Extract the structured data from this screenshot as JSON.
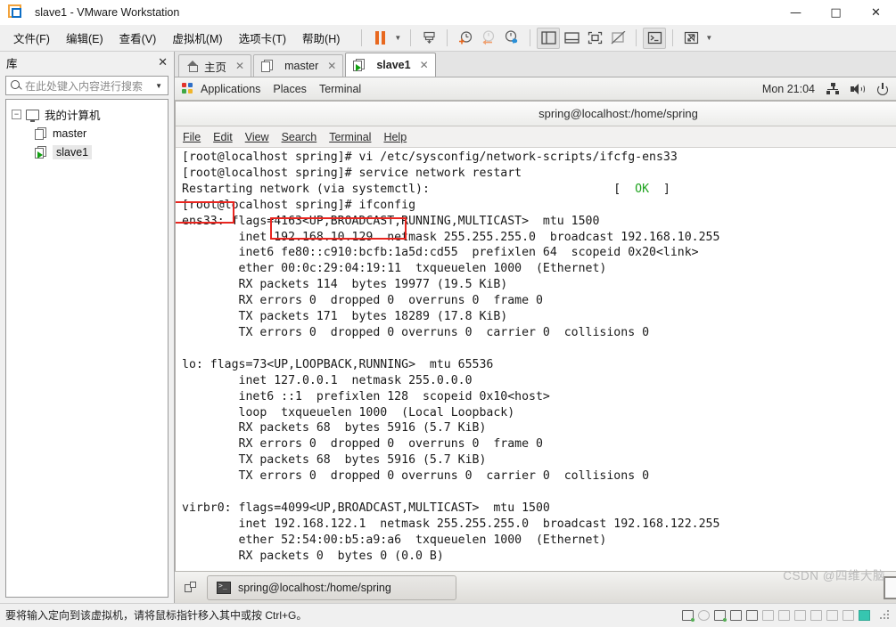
{
  "window": {
    "title": "slave1 - VMware Workstation",
    "controls": {
      "minimize": "—",
      "maximize": "□",
      "close": "✕"
    }
  },
  "menubar": {
    "items": [
      {
        "label": "文件(F)",
        "name": "menu-file"
      },
      {
        "label": "编辑(E)",
        "name": "menu-edit"
      },
      {
        "label": "查看(V)",
        "name": "menu-view"
      },
      {
        "label": "虚拟机(M)",
        "name": "menu-vm"
      },
      {
        "label": "选项卡(T)",
        "name": "menu-tabs"
      },
      {
        "label": "帮助(H)",
        "name": "menu-help"
      }
    ]
  },
  "toolbar": {
    "buttons": [
      "pause-button",
      "pause-dropdown",
      "power-settings-button",
      "snapshot-take-button",
      "snapshot-revert-button",
      "snapshot-manager-button",
      "show-library-button",
      "show-thumbnails-button",
      "fullscreen-button",
      "unity-button",
      "console-view-button",
      "stretch-button",
      "stretch-dropdown"
    ]
  },
  "library": {
    "title": "库",
    "close": "✕",
    "search_placeholder": "在此处键入内容进行搜索",
    "tree": [
      {
        "label": "我的计算机",
        "level": 0,
        "expander": "−",
        "icon": "monitor-icon",
        "selected": false
      },
      {
        "label": "master",
        "level": 1,
        "icon": "vm-icon",
        "selected": false,
        "running": false
      },
      {
        "label": "slave1",
        "level": 1,
        "icon": "vm-running-icon",
        "selected": true,
        "running": true
      }
    ]
  },
  "tabs": [
    {
      "label": "主页",
      "icon": "home-icon",
      "active": false,
      "close": "✕"
    },
    {
      "label": "master",
      "icon": "vm-icon",
      "active": false,
      "close": "✕"
    },
    {
      "label": "slave1",
      "icon": "vm-running-icon",
      "active": true,
      "close": "✕"
    }
  ],
  "guest": {
    "panel": {
      "menus": [
        "Applications",
        "Places",
        "Terminal"
      ],
      "clock": "Mon 21:04",
      "tray": [
        "network-icon",
        "volume-icon",
        "power-icon"
      ]
    },
    "terminal": {
      "title": "spring@localhost:/home/spring",
      "controls": {
        "minimize": "_",
        "maximize": "▫",
        "close": "✕"
      },
      "menus": [
        "File",
        "Edit",
        "View",
        "Search",
        "Terminal",
        "Help"
      ],
      "lines": [
        "[root@localhost spring]# vi /etc/sysconfig/network-scripts/ifcfg-ens33",
        "[root@localhost spring]# service network restart",
        "Restarting network (via systemctl):                          [  OK  ]",
        "[root@localhost spring]# ifconfig",
        "ens33: flags=4163<UP,BROADCAST,RUNNING,MULTICAST>  mtu 1500",
        "        inet 192.168.10.129  netmask 255.255.255.0  broadcast 192.168.10.255",
        "        inet6 fe80::c910:bcfb:1a5d:cd55  prefixlen 64  scopeid 0x20<link>",
        "        ether 00:0c:29:04:19:11  txqueuelen 1000  (Ethernet)",
        "        RX packets 114  bytes 19977 (19.5 KiB)",
        "        RX errors 0  dropped 0  overruns 0  frame 0",
        "        TX packets 171  bytes 18289 (17.8 KiB)",
        "        TX errors 0  dropped 0 overruns 0  carrier 0  collisions 0",
        "",
        "lo: flags=73<UP,LOOPBACK,RUNNING>  mtu 65536",
        "        inet 127.0.0.1  netmask 255.0.0.0",
        "        inet6 ::1  prefixlen 128  scopeid 0x10<host>",
        "        loop  txqueuelen 1000  (Local Loopback)",
        "        RX packets 68  bytes 5916 (5.7 KiB)",
        "        RX errors 0  dropped 0  overruns 0  frame 0",
        "        TX packets 68  bytes 5916 (5.7 KiB)",
        "        TX errors 0  dropped 0 overruns 0  carrier 0  collisions 0",
        "",
        "virbr0: flags=4099<UP,BROADCAST,MULTICAST>  mtu 1500",
        "        inet 192.168.122.1  netmask 255.255.255.0  broadcast 192.168.122.255",
        "        ether 52:54:00:b5:a9:a6  txqueuelen 1000  (Ethernet)",
        "        RX packets 0  bytes 0 (0.0 B)"
      ],
      "ok_status": "OK"
    },
    "taskbar": {
      "window_button": "spring@localhost:/home/spring",
      "workspaces": 4,
      "active_workspace": 1
    },
    "annotations": [
      {
        "name": "highlight-interface-name",
        "target": "ens33:",
        "color": "#e8251f"
      },
      {
        "name": "highlight-ip-address",
        "target": "192.168.10.129",
        "color": "#e8251f"
      }
    ]
  },
  "statusbar": {
    "hint": "要将输入定向到该虚拟机，请将鼠标指针移入其中或按 Ctrl+G。"
  },
  "watermark": "CSDN @四维大脑",
  "colors": {
    "accent_orange": "#e8681f",
    "vmware_blue": "#0f6fc5",
    "terminal_ok_green": "#1fa31f",
    "annotation_red": "#e8251f",
    "desktop_blue": "#1b3a57"
  }
}
